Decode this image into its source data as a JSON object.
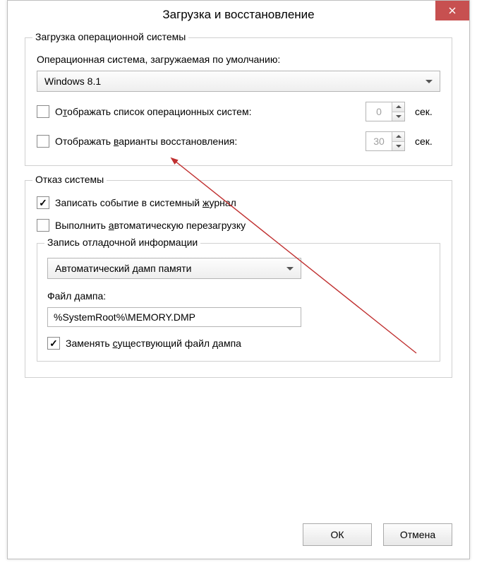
{
  "window": {
    "title": "Загрузка и восстановление"
  },
  "boot": {
    "group_title": "Загрузка операционной системы",
    "default_os_label": "Операционная система, загружаемая по умолчанию:",
    "default_os_value": "Windows 8.1",
    "show_os_list_label": "Отображать список операционных систем:",
    "show_os_list_checked": false,
    "show_os_list_seconds": "0",
    "show_recovery_label": "Отображать варианты восстановления:",
    "show_recovery_checked": false,
    "show_recovery_seconds": "30",
    "seconds_unit": "сек."
  },
  "failure": {
    "group_title": "Отказ системы",
    "write_event_label": "Записать событие в системный журнал",
    "write_event_checked": true,
    "auto_restart_label": "Выполнить автоматическую перезагрузку",
    "auto_restart_checked": false,
    "debug_info": {
      "title": "Запись отладочной информации",
      "dump_type_value": "Автоматический дамп памяти",
      "dump_file_label": "Файл дампа:",
      "dump_file_value": "%SystemRoot%\\MEMORY.DMP",
      "overwrite_label": "Заменять существующий файл дампа",
      "overwrite_checked": true
    }
  },
  "buttons": {
    "ok": "ОК",
    "cancel": "Отмена"
  }
}
